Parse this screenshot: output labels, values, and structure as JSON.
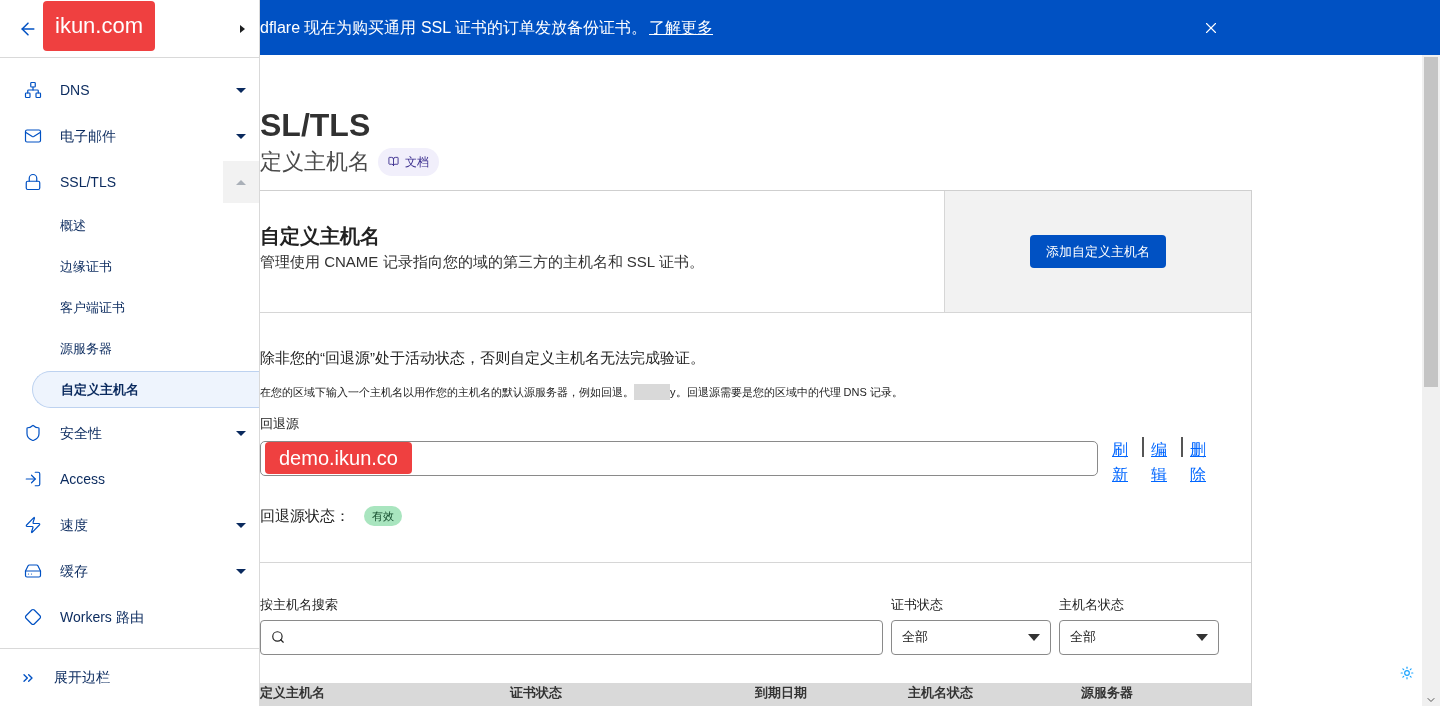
{
  "sidebar": {
    "domain": "ikun.com",
    "items": [
      {
        "kind": "group",
        "label": "DNS",
        "expanded": false
      },
      {
        "kind": "group",
        "label": "电子邮件",
        "expanded": false
      },
      {
        "kind": "group",
        "label": "SSL/TLS",
        "expanded": true,
        "children": [
          {
            "label": "概述",
            "selected": false
          },
          {
            "label": "边缘证书",
            "selected": false
          },
          {
            "label": "客户端证书",
            "selected": false
          },
          {
            "label": "源服务器",
            "selected": false
          },
          {
            "label": "自定义主机名",
            "selected": true
          }
        ]
      },
      {
        "kind": "group",
        "label": "安全性",
        "expanded": false
      },
      {
        "kind": "link",
        "label": "Access"
      },
      {
        "kind": "group",
        "label": "速度",
        "expanded": false
      },
      {
        "kind": "group",
        "label": "缓存",
        "expanded": false
      },
      {
        "kind": "link",
        "label": "Workers 路由"
      }
    ],
    "footer": "展开边栏"
  },
  "banner": {
    "text": "dflare 现在为购买通用 SSL 证书的订单发放备份证书。",
    "link": "了解更多"
  },
  "page": {
    "title": "SL/TLS",
    "subtitle": "定义主机名",
    "docs": "文档"
  },
  "custom_hostnames": {
    "title": "自定义主机名",
    "description": "管理使用 CNAME 记录指向您的域的第三方的主机名和 SSL 证书。",
    "add_button": "添加自定义主机名"
  },
  "fallback": {
    "warning": "除非您的“回退源”处于活动状态，否则自定义主机名无法完成验证。",
    "hint_before": "在您的区域下输入一个主机名以用作您的主机名的默认源服务器，例如回退。",
    "hint_after": "y。回退源需要是您的区域中的代理 DNS 记录。",
    "label": "回退源",
    "value": "demo.ikun.co",
    "actions": [
      "刷新",
      "编辑",
      "删除"
    ],
    "status_label": "回退源状态：",
    "status": "有效"
  },
  "filters": {
    "search_label": "按主机名搜索",
    "selects": [
      {
        "label": "证书状态",
        "value": "全部"
      },
      {
        "label": "主机名状态",
        "value": "全部"
      }
    ]
  },
  "table": {
    "columns": [
      "定义主机名",
      "证书状态",
      "到期日期",
      "主机名状态",
      "源服务器"
    ]
  }
}
